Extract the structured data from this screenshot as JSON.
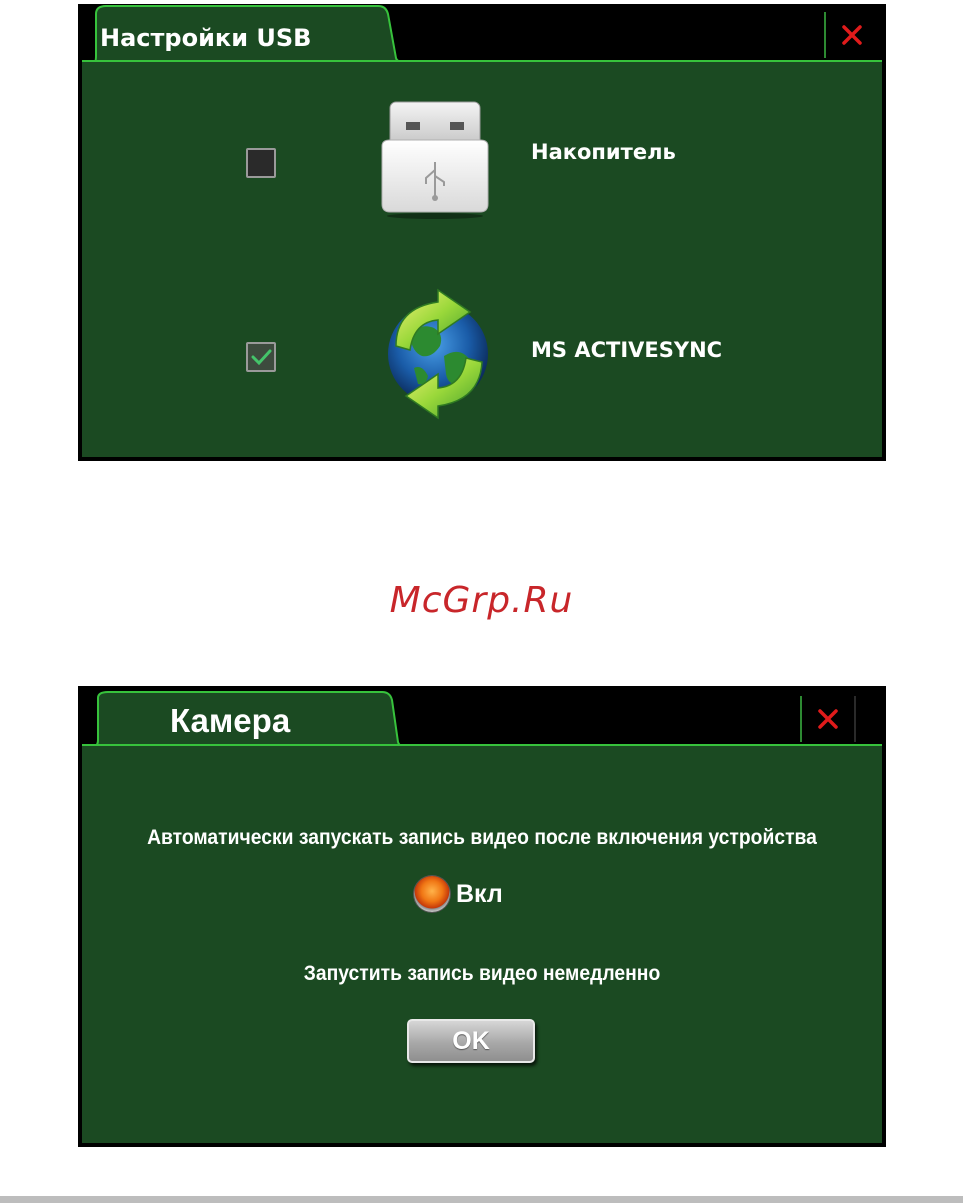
{
  "usb_dialog": {
    "title": "Настройки USB",
    "close_icon": "close-x-icon",
    "options": [
      {
        "label": "Накопитель",
        "checked": false,
        "icon": "usb-drive-icon"
      },
      {
        "label": "MS ACTIVESYNC",
        "checked": true,
        "icon": "activesync-globe-icon"
      }
    ]
  },
  "watermark": "McGrp.Ru",
  "camera_dialog": {
    "title": "Камера",
    "close_icon": "close-x-icon",
    "auto_record_text": "Автоматически запускать запись видео после включения устройства",
    "radio_label": "Вкл",
    "record_now_text": "Запустить запись видео немедленно",
    "ok_label": "OK"
  },
  "colors": {
    "panel_bg": "#1b4a22",
    "accent_green": "#37c23c",
    "close_red": "#e01b1b",
    "watermark_red": "#c8262a"
  }
}
